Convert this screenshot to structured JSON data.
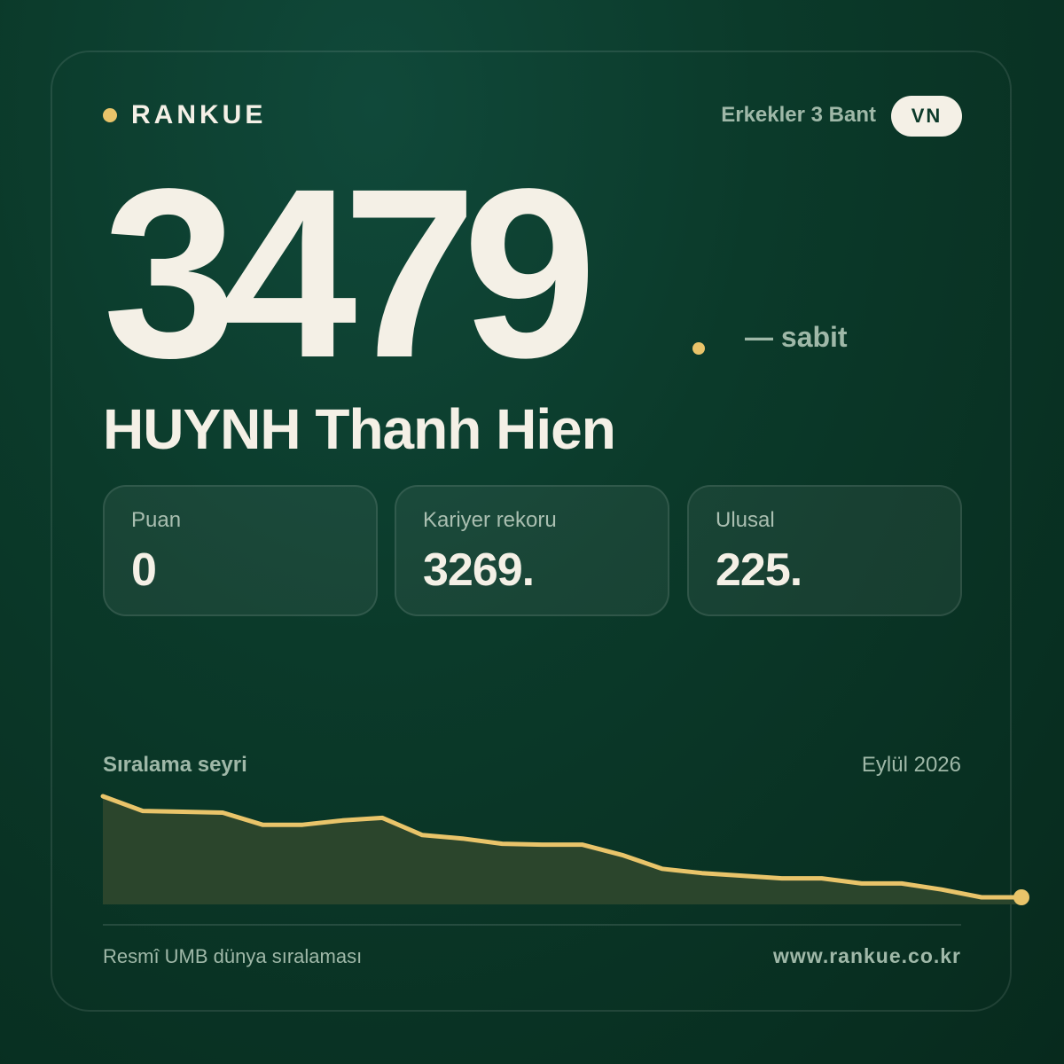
{
  "brand": {
    "name": "RANKUE",
    "accent": "#e9c46a"
  },
  "category": "Erkekler 3 Bant",
  "country": "VN",
  "rank": {
    "value": "3479",
    "change": "— sabit"
  },
  "player": {
    "name": "HUYNH Thanh Hien"
  },
  "stats": [
    {
      "label": "Puan",
      "value": "0"
    },
    {
      "label": "Kariyer rekoru",
      "value": "3269."
    },
    {
      "label": "Ulusal",
      "value": "225."
    }
  ],
  "chart": {
    "title": "Sıralama seyri",
    "date": "Eylül 2026"
  },
  "chart_data": {
    "type": "area",
    "title": "Sıralama seyri",
    "values": [
      3269,
      3286,
      3287,
      3288,
      3302,
      3302,
      3297,
      3294,
      3314,
      3318,
      3324,
      3325,
      3325,
      3337,
      3353,
      3358,
      3361,
      3364,
      3364,
      3370,
      3370,
      3377,
      3386,
      3386
    ],
    "y_inverted": true,
    "grid": false,
    "line_color": "#e9c46a",
    "fill_color": "#2b452c"
  },
  "footer": {
    "source": "Resmî UMB dünya sıralaması",
    "website": "www.rankue.co.kr"
  }
}
